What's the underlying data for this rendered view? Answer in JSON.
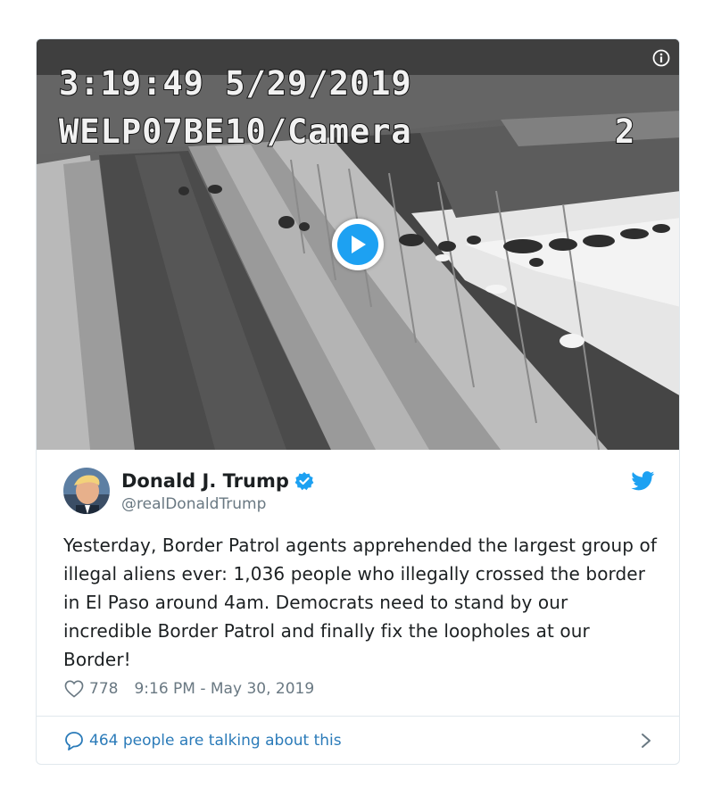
{
  "media": {
    "overlay_line1": "3:19:49 5/29/2019",
    "overlay_line2": "WELP07BE10/Camera",
    "overlay_camera_number": "2",
    "info_icon": "info-icon",
    "play_icon": "play-icon"
  },
  "author": {
    "display_name": "Donald J. Trump",
    "handle": "@realDonaldTrump",
    "verified_icon": "verified-badge-icon",
    "avatar": "avatar"
  },
  "brand_icon": "twitter-bird-icon",
  "tweet": {
    "text": "Yesterday, Border Patrol agents apprehended the largest group of illegal aliens ever: 1,036 people who illegally crossed the border in El Paso around 4am. Democrats need to stand by our incredible Border Patrol and finally fix the loopholes at our Border!"
  },
  "meta": {
    "like_count": "778",
    "timestamp": "9:16 PM - May 30, 2019"
  },
  "footer": {
    "talking_label": "464 people are talking about this"
  },
  "colors": {
    "accent": "#1da1f2",
    "link": "#2b7bb9",
    "muted": "#697882",
    "text": "#1c2022",
    "border": "#e1e8ed"
  }
}
